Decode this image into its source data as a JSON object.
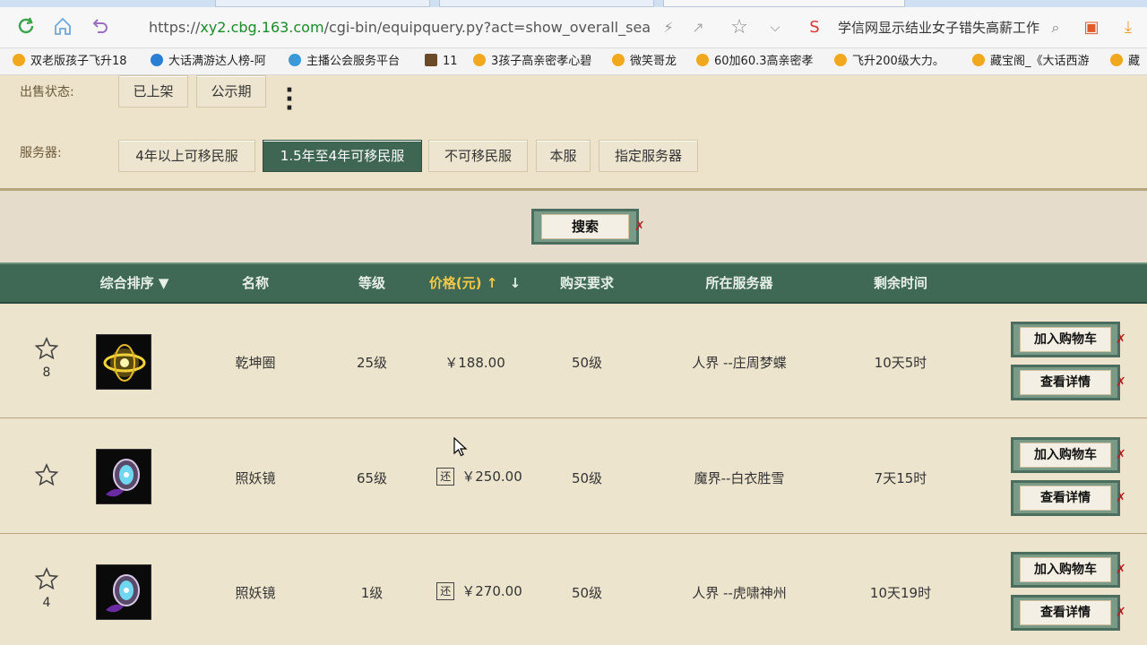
{
  "browser": {
    "url_prefix": "https://",
    "url_host": "xy2.cbg.163.com",
    "url_path": "/cgi-bin/equipquery.py?act=show_overall_sea",
    "search_text": "学信网显示结业女子错失高薪工作"
  },
  "bookmarks": [
    "双老版孩子飞升18",
    "大话满游达人榜-阿",
    "主播公会服务平台",
    "11",
    "3孩子高亲密孝心碧",
    "微笑哥龙",
    "60加60.3高亲密孝",
    "飞升200级大力。",
    "藏宝阁_《大话西游",
    "藏"
  ],
  "filters": {
    "sale_status_label": "出售状态:",
    "sale_status_options": [
      "已上架",
      "公示期"
    ],
    "server_label": "服务器:",
    "server_options": [
      "4年以上可移民服",
      "1.5年至4年可移民服",
      "不可移民服",
      "本服",
      "指定服务器"
    ],
    "server_active": "1.5年至4年可移民服"
  },
  "search_button": "搜索",
  "table": {
    "headers": {
      "sort": "综合排序",
      "name": "名称",
      "level": "等级",
      "price": "价格(元)",
      "requirement": "购买要求",
      "server": "所在服务器",
      "time_left": "剩余时间"
    },
    "rows": [
      {
        "fav_count": "8",
        "name": "乾坤圈",
        "level": "25级",
        "return_badge": "",
        "price": "￥188.00",
        "requirement": "50级",
        "server": "人界 --庄周梦蝶",
        "time_left": "10天5时"
      },
      {
        "fav_count": "",
        "name": "照妖镜",
        "level": "65级",
        "return_badge": "还",
        "price": "￥250.00",
        "requirement": "50级",
        "server": "魔界--白衣胜雪",
        "time_left": "7天15时"
      },
      {
        "fav_count": "4",
        "name": "照妖镜",
        "level": "1级",
        "return_badge": "还",
        "price": "￥270.00",
        "requirement": "50级",
        "server": "人界 --虎啸神州",
        "time_left": "10天19时"
      }
    ],
    "add_cart_label": "加入购物车",
    "view_detail_label": "查看详情"
  },
  "colors": {
    "header_bg": "#3f6955",
    "active_filter": "#3e6652",
    "page_bg": "#ede4ce",
    "price_highlight": "#f3c94a"
  }
}
